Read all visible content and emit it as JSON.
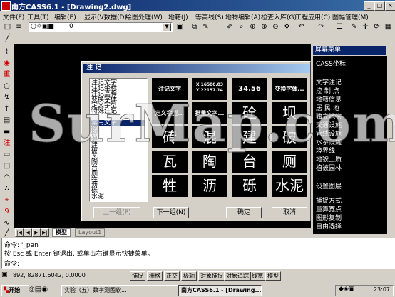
{
  "window": {
    "title": "南方CASS6.1 - [Drawing2.dwg]"
  },
  "menubar": {
    "items": [
      "文件(F)",
      "工具(T)",
      "编辑(E)",
      "显示(V)",
      "数据(D)",
      "绘图处理(W)",
      "地籍(J)",
      "等高线(S)",
      "地物编辑(A)",
      "检查入库(G)",
      "工程应用(C)",
      "图幅管理(M)"
    ]
  },
  "toolbar": {
    "layer_value": "0",
    "layer_dropdown_icon": "chevron-down-icon"
  },
  "screen_menu": {
    "title": "屏幕菜单",
    "items": [
      "CASS坐标",
      "文字注记",
      "控 制 点",
      "地籍信息",
      "居 民 地",
      "独立地物",
      "交通设施",
      "管线设施",
      "水系设施",
      "境界线",
      "地貌土质",
      "植被园林",
      "设置图层",
      "捕捉方式",
      "量算宽点",
      "图形复制",
      "自由选择"
    ]
  },
  "dialog": {
    "title": "注 记",
    "list_items": [
      "注记文字",
      "注记坐标",
      "注记高程",
      "变换字体",
      "定义字型",
      "特殊注记",
      "",
      "常用文字",
      "碗",
      "砼",
      "混",
      "建",
      "破",
      "瓦",
      "陶",
      "台",
      "厕",
      "牲",
      "沥",
      "砾",
      "水泥"
    ],
    "selected_index": 7,
    "cells": [
      {
        "text": "注记文字",
        "kind": "small"
      },
      {
        "text": "X 16580.83\nY 22157.14",
        "kind": "coord"
      },
      {
        "text": "34.56",
        "kind": "elev"
      },
      {
        "text": "变换字体...",
        "kind": "small"
      },
      {
        "text": "定义字型...",
        "kind": "small"
      },
      {
        "text": "批量文字...",
        "kind": "small"
      },
      {
        "text": "砼",
        "kind": "big"
      },
      {
        "text": "坝",
        "kind": "big"
      },
      {
        "text": "砖",
        "kind": "big"
      },
      {
        "text": "混",
        "kind": "big"
      },
      {
        "text": "建",
        "kind": "big"
      },
      {
        "text": "破",
        "kind": "big"
      },
      {
        "text": "瓦",
        "kind": "big"
      },
      {
        "text": "陶",
        "kind": "big"
      },
      {
        "text": "台",
        "kind": "big"
      },
      {
        "text": "厕",
        "kind": "big"
      },
      {
        "text": "牲",
        "kind": "big"
      },
      {
        "text": "沥",
        "kind": "big"
      },
      {
        "text": "砾",
        "kind": "big"
      },
      {
        "text": "水泥",
        "kind": "big"
      }
    ],
    "buttons": {
      "prev": "上一组(P)",
      "next": "下一组(N)",
      "ok": "确定",
      "cancel": "取消"
    }
  },
  "tabs": {
    "model": "模型",
    "layout": "Layout1"
  },
  "command": {
    "line1": "命令: '_pan",
    "line2": "按 Esc 或 Enter 键退出, 或单击右键显示快捷菜单。",
    "line3": "命令:"
  },
  "status": {
    "coords": "892, 82871.6042, 0.0000",
    "buttons": [
      "捕捉",
      "栅格",
      "正交",
      "极轴",
      "对象捕捉",
      "对象追踪",
      "线宽",
      "模型"
    ]
  },
  "taskbar": {
    "start": "开始",
    "tasks": [
      "实验（五）数字测图软...",
      "南方CASS6.1 - [Drawing..."
    ],
    "clock": "23:07"
  },
  "watermark": "SurMap.com",
  "colors": {
    "titlebar": "#0a246a",
    "canvas": "#000000",
    "chrome": "#d4d0c8"
  }
}
